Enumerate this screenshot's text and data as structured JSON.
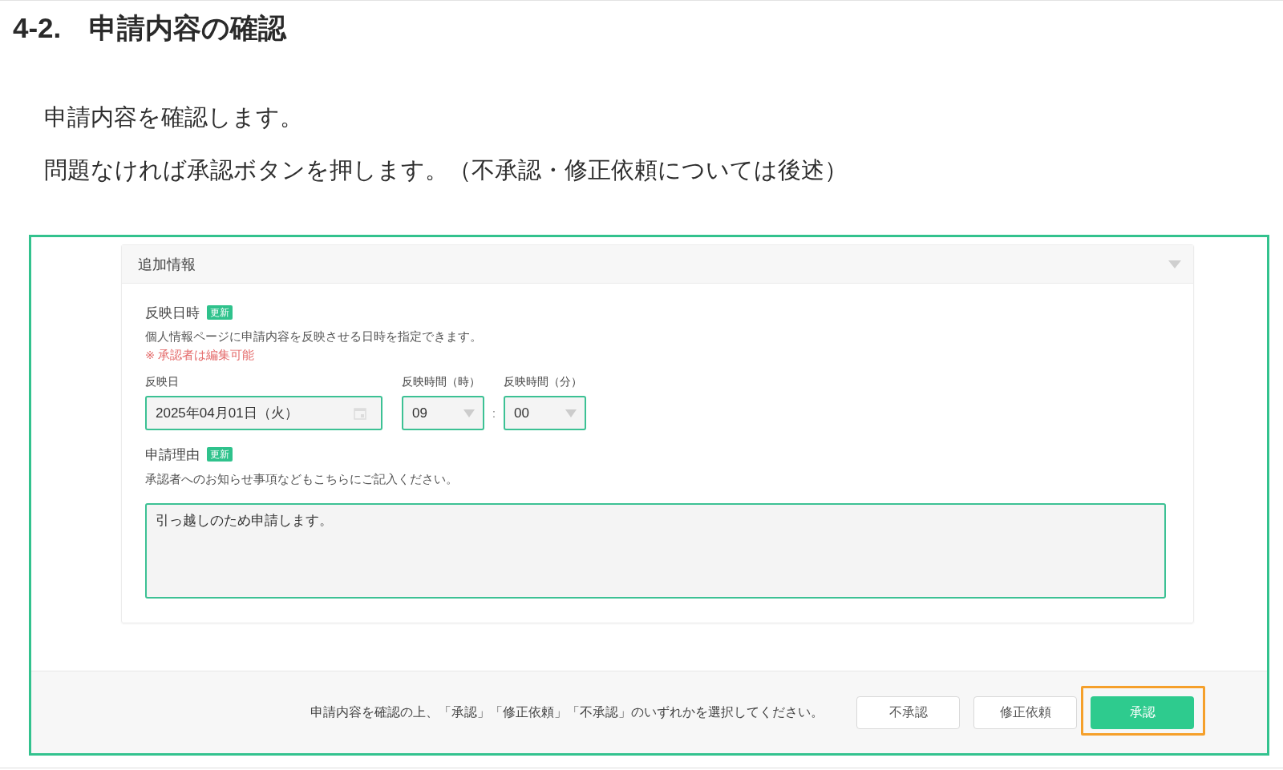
{
  "heading": "4-2.　申請内容の確認",
  "paragraphs": [
    "申請内容を確認します。",
    "問題なければ承認ボタンを押します。（不承認・修正依頼については後述）"
  ],
  "screenshot": {
    "panel": {
      "title": "追加情報",
      "sections": [
        {
          "kind": "datetime",
          "label": "反映日時",
          "badge": "更新",
          "description": "個人情報ページに申請内容を反映させる日時を指定できます。",
          "note": "※ 承認者は編集可能",
          "fields": [
            {
              "kind": "date",
              "label": "反映日",
              "value": "2025年04月01日（火）"
            },
            {
              "kind": "select",
              "label": "反映時間（時）",
              "value": "09"
            },
            {
              "kind": "separator",
              "text": ":"
            },
            {
              "kind": "select",
              "label": "反映時間（分）",
              "value": "00"
            }
          ]
        },
        {
          "kind": "textarea",
          "label": "申請理由",
          "badge": "更新",
          "description": "承認者へのお知らせ事項などもこちらにご記入ください。",
          "value": "引っ越しのため申請します。"
        }
      ]
    },
    "footer": {
      "message": "申請内容を確認の上、「承認」「修正依頼」「不承認」のいずれかを選択してください。",
      "buttons": [
        {
          "kind": "secondary",
          "label": "不承認",
          "highlighted": false
        },
        {
          "kind": "secondary",
          "label": "修正依頼",
          "highlighted": false
        },
        {
          "kind": "primary",
          "label": "承認",
          "highlighted": true
        }
      ]
    }
  }
}
